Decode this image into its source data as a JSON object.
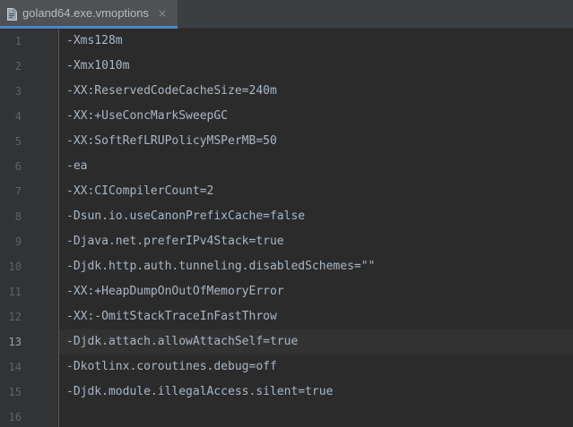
{
  "tab": {
    "label": "goland64.exe.vmoptions",
    "close_glyph": "×",
    "icon": "file-icon"
  },
  "editor": {
    "active_line": 13,
    "lines": [
      {
        "number": "1",
        "text": "-Xms128m"
      },
      {
        "number": "2",
        "text": "-Xmx1010m"
      },
      {
        "number": "3",
        "text": "-XX:ReservedCodeCacheSize=240m"
      },
      {
        "number": "4",
        "text": "-XX:+UseConcMarkSweepGC"
      },
      {
        "number": "5",
        "text": "-XX:SoftRefLRUPolicyMSPerMB=50"
      },
      {
        "number": "6",
        "text": "-ea"
      },
      {
        "number": "7",
        "text": "-XX:CICompilerCount=2"
      },
      {
        "number": "8",
        "text": "-Dsun.io.useCanonPrefixCache=false"
      },
      {
        "number": "9",
        "text": "-Djava.net.preferIPv4Stack=true"
      },
      {
        "number": "10",
        "text": "-Djdk.http.auth.tunneling.disabledSchemes=\"\""
      },
      {
        "number": "11",
        "text": "-XX:+HeapDumpOnOutOfMemoryError"
      },
      {
        "number": "12",
        "text": "-XX:-OmitStackTraceInFastThrow"
      },
      {
        "number": "13",
        "text": "-Djdk.attach.allowAttachSelf=true"
      },
      {
        "number": "14",
        "text": "-Dkotlinx.coroutines.debug=off"
      },
      {
        "number": "15",
        "text": "-Djdk.module.illegalAccess.silent=true"
      },
      {
        "number": "16",
        "text": ""
      }
    ]
  },
  "colors": {
    "background": "#2b2b2b",
    "gutter": "#313335",
    "tab_active": "#4e5254",
    "tab_underline": "#4a88c7",
    "code_text": "#a9b7c6",
    "line_number": "#606366"
  }
}
